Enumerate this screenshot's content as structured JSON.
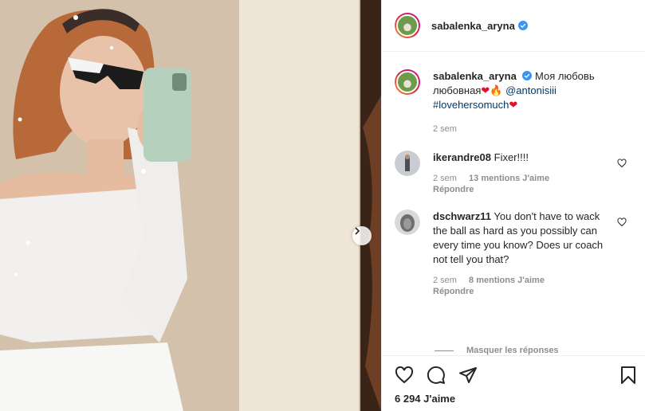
{
  "post": {
    "username": "sabalenka_aryna",
    "verified": true
  },
  "caption": {
    "username": "sabalenka_aryna",
    "text_line1": "Моя любовь",
    "text_line2": "любовная",
    "mention": "@antonisiii",
    "hashtag": "#lovehersomuch",
    "time": "2 sem"
  },
  "comments": [
    {
      "username": "ikerandre08",
      "text": "Fixer!!!!",
      "time": "2 sem",
      "likes": "13 mentions J'aime",
      "reply": "Répondre"
    },
    {
      "username": "dschwarz11",
      "text": "You don't have to wack the ball as hard as you possibly can every time you know? Does ur coach not tell you that?",
      "time": "2 sem",
      "likes": "8 mentions J'aime",
      "reply": "Répondre"
    }
  ],
  "hidden_replies": "Masquer les réponses",
  "likes_count": "6 294 J'aime",
  "icons": {
    "like": "heart-icon",
    "comment": "comment-icon",
    "share": "share-icon",
    "save": "bookmark-icon",
    "next": "chevron-right-icon",
    "verified": "verified-badge-icon"
  },
  "colors": {
    "verified": "#3897f0",
    "heart_emoji": "#e0102a",
    "link": "#00376b",
    "meta": "#8e8e8e"
  }
}
